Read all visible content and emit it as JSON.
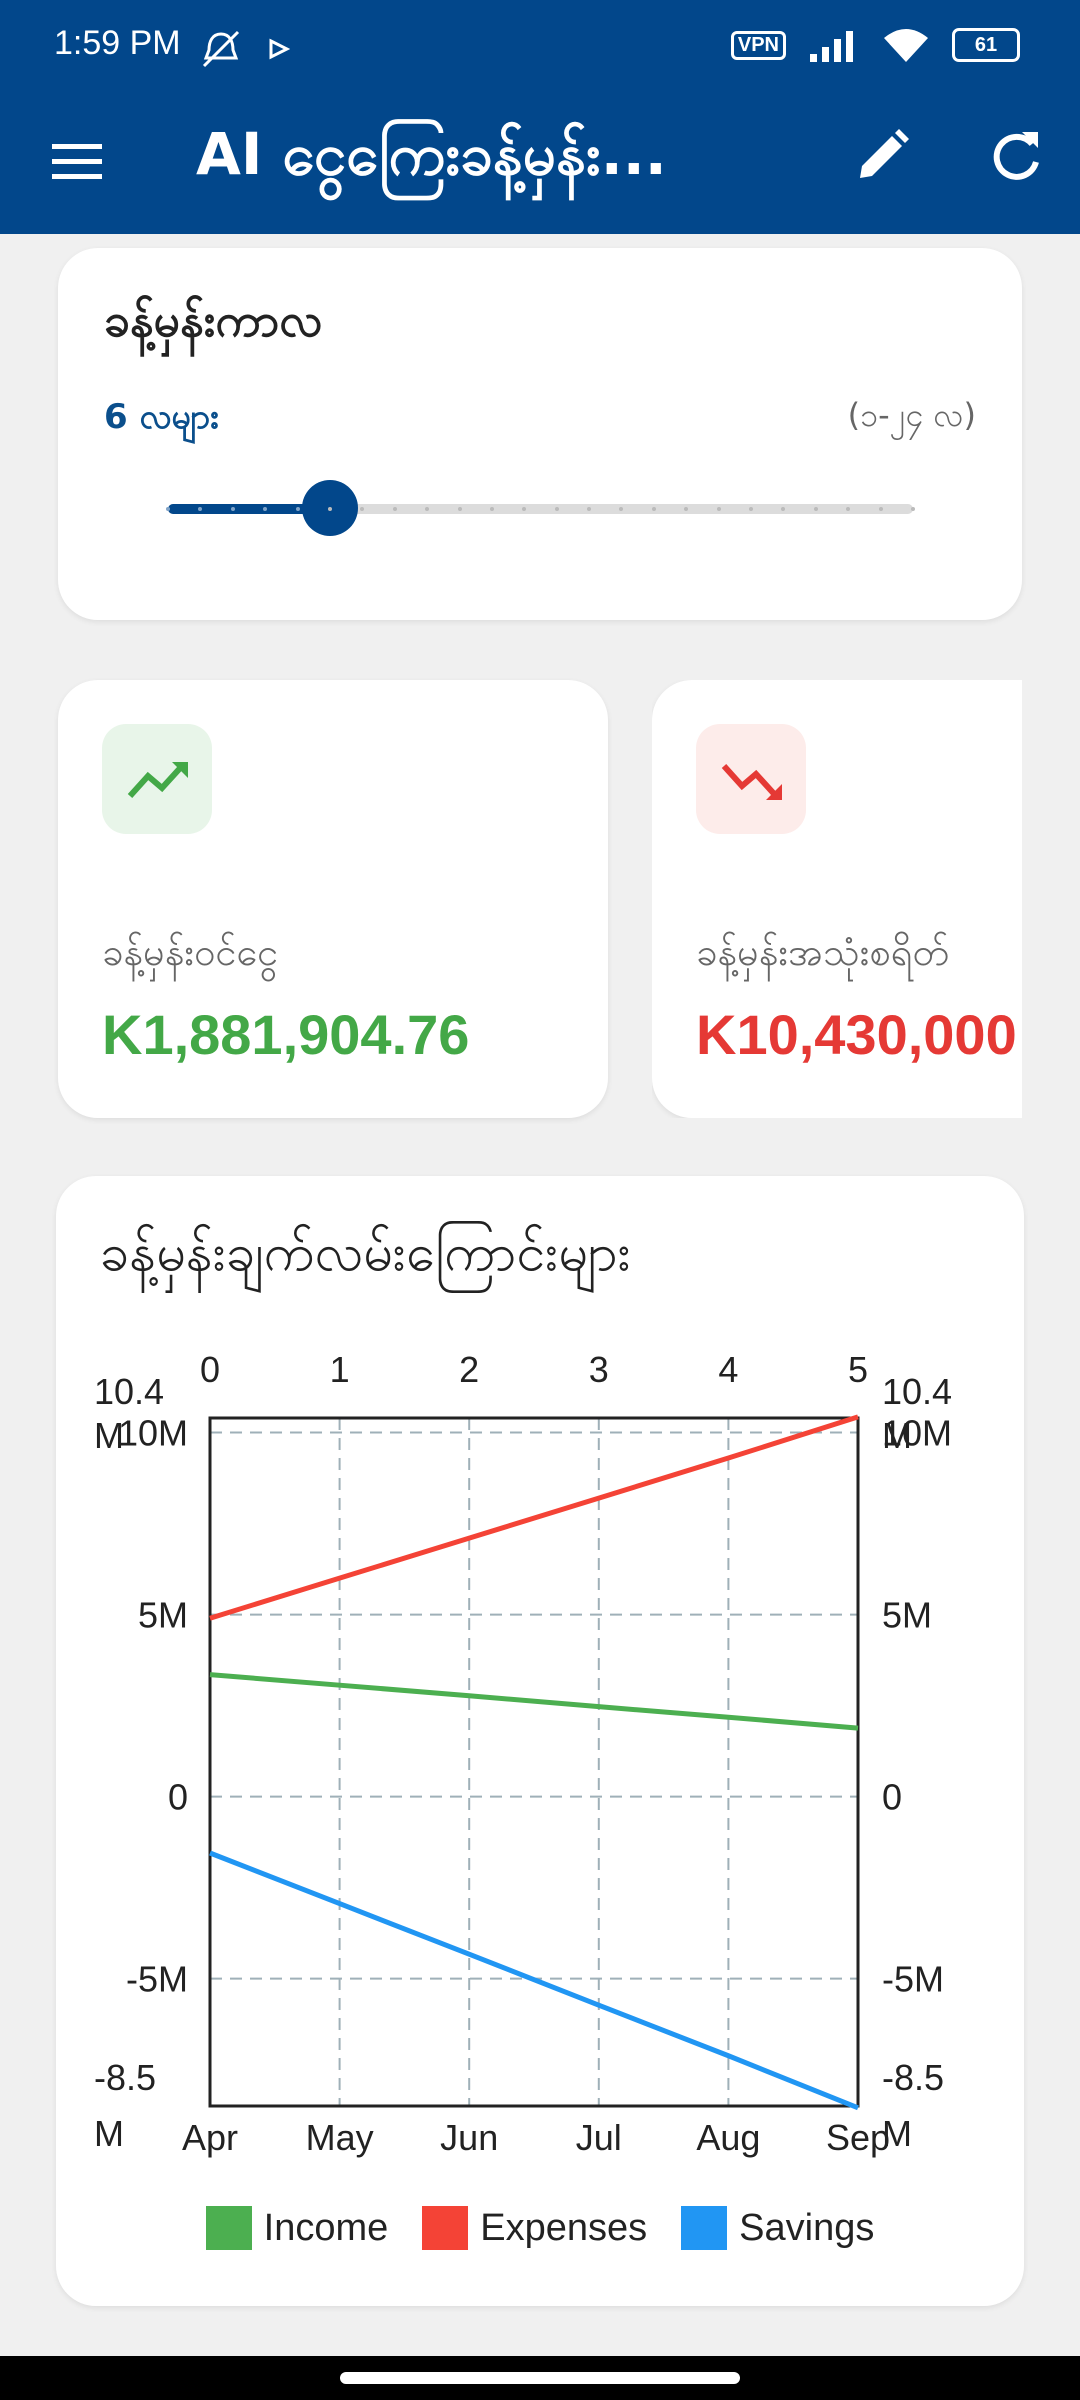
{
  "status": {
    "time": "1:59 PM",
    "vpn": "VPN",
    "battery": "61"
  },
  "appbar": {
    "title": "AI ငွေကြေးခန့်မှန်း..."
  },
  "period": {
    "title": "ခန့်မှန်းကာလ",
    "value": "6 လများ",
    "range": "(၁-၂၄ လ)",
    "months": 6,
    "min": 1,
    "max": 24
  },
  "cards": [
    {
      "label": "ခန့်မှန်းဝင်ငွေ",
      "value": "K1,881,904.76",
      "color": "#43a847",
      "icon": "trending-up-icon"
    },
    {
      "label": "ခန့်မှန်းအသုံးစရိတ်",
      "value": "K10,430,000",
      "color": "#e53935",
      "icon": "trending-down-icon"
    }
  ],
  "chart_title": "ခန့်မှန်းချက်လမ်းကြောင်းများ",
  "chart_data": {
    "type": "line",
    "categories": [
      "Apr",
      "May",
      "Jun",
      "Jul",
      "Aug",
      "Sep"
    ],
    "top_x_ticks": [
      "0",
      "1",
      "2",
      "3",
      "4",
      "5"
    ],
    "ylim": [
      -8500000,
      10400000
    ],
    "y_ticks": [
      {
        "value": 10000000,
        "label": "10M"
      },
      {
        "value": 5000000,
        "label": "5M"
      },
      {
        "value": 0,
        "label": "0"
      },
      {
        "value": -5000000,
        "label": "-5M"
      }
    ],
    "y_max_label": [
      "10.4",
      "M"
    ],
    "y_min_label": [
      "-8.5",
      "M"
    ],
    "grid": true,
    "legend": "bottom",
    "series": [
      {
        "name": "Income",
        "color": "#4caf50",
        "values": [
          3350000,
          3060000,
          2770000,
          2470000,
          2180000,
          1880000
        ]
      },
      {
        "name": "Expenses",
        "color": "#f44336",
        "values": [
          4900000,
          6000000,
          7100000,
          8200000,
          9300000,
          10430000
        ]
      },
      {
        "name": "Savings",
        "color": "#2196f3",
        "values": [
          -1550000,
          -2940000,
          -4330000,
          -5730000,
          -7120000,
          -8550000
        ]
      }
    ]
  }
}
